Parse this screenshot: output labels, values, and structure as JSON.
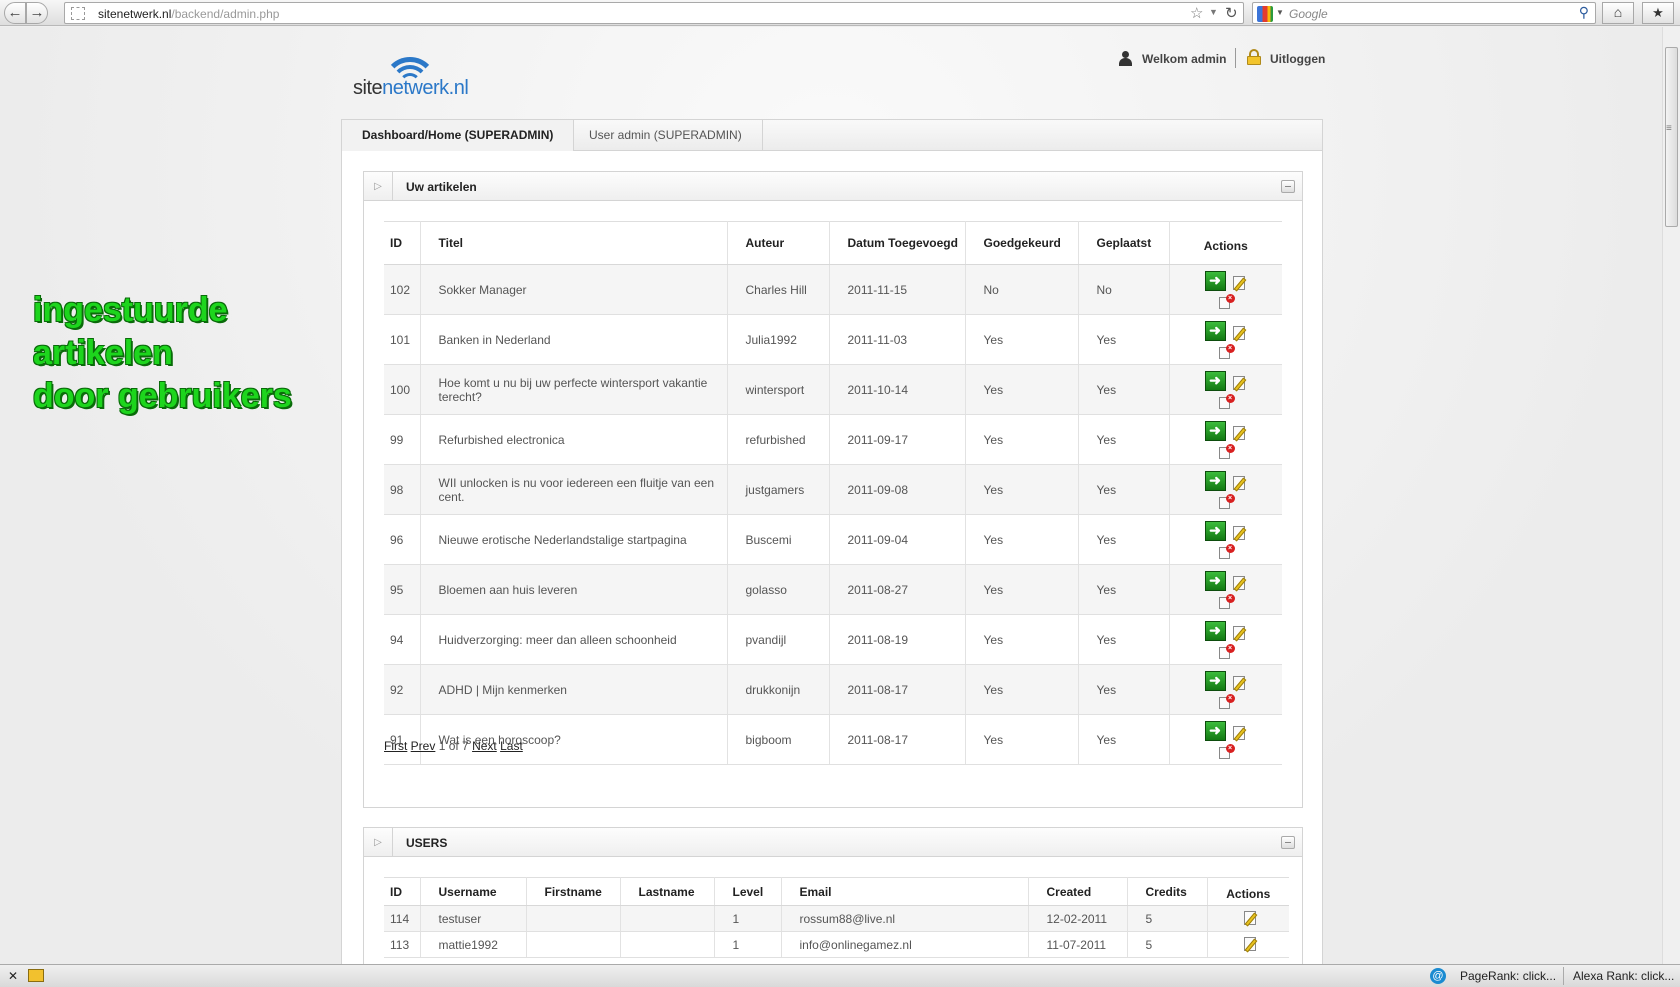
{
  "browser": {
    "url_domain": "sitenetwerk.nl",
    "url_path": "/backend/admin.php",
    "search_placeholder": "Google",
    "status_pagerank": "PageRank: click...",
    "status_alexa": "Alexa Rank: click..."
  },
  "header": {
    "logo_site": "site",
    "logo_rest": "netwerk.nl",
    "welcome": "Welkom admin",
    "logout": "Uitloggen"
  },
  "overlay": {
    "line1": "ingestuurde",
    "line2": "artikelen",
    "line3": "door gebruikers",
    "color": "#1dd51d"
  },
  "tabs": [
    {
      "label": "Dashboard/Home (SUPERADMIN)",
      "active": true
    },
    {
      "label": "User admin (SUPERADMIN)",
      "active": false
    }
  ],
  "articles": {
    "title": "Uw artikelen",
    "columns": [
      "ID",
      "Titel",
      "Auteur",
      "Datum Toegevoegd",
      "Goedgekeurd",
      "Geplaatst",
      "Actions"
    ],
    "rows": [
      {
        "id": "102",
        "titel": "Sokker Manager",
        "auteur": "Charles Hill",
        "datum": "2011-11-15",
        "goed": "No",
        "gepl": "No"
      },
      {
        "id": "101",
        "titel": "Banken in Nederland",
        "auteur": "Julia1992",
        "datum": "2011-11-03",
        "goed": "Yes",
        "gepl": "Yes"
      },
      {
        "id": "100",
        "titel": "Hoe komt u nu bij uw perfecte wintersport vakantie terecht?",
        "auteur": "wintersport",
        "datum": "2011-10-14",
        "goed": "Yes",
        "gepl": "Yes"
      },
      {
        "id": "99",
        "titel": "Refurbished electronica",
        "auteur": "refurbished",
        "datum": "2011-09-17",
        "goed": "Yes",
        "gepl": "Yes"
      },
      {
        "id": "98",
        "titel": "WII unlocken is nu voor iedereen een fluitje van een cent.",
        "auteur": "justgamers",
        "datum": "2011-09-08",
        "goed": "Yes",
        "gepl": "Yes"
      },
      {
        "id": "96",
        "titel": "Nieuwe erotische Nederlandstalige startpagina",
        "auteur": "Buscemi",
        "datum": "2011-09-04",
        "goed": "Yes",
        "gepl": "Yes"
      },
      {
        "id": "95",
        "titel": "Bloemen aan huis leveren",
        "auteur": "golasso",
        "datum": "2011-08-27",
        "goed": "Yes",
        "gepl": "Yes"
      },
      {
        "id": "94",
        "titel": "Huidverzorging: meer dan alleen schoonheid",
        "auteur": "pvandijl",
        "datum": "2011-08-19",
        "goed": "Yes",
        "gepl": "Yes"
      },
      {
        "id": "92",
        "titel": "ADHD | Mijn kenmerken",
        "auteur": "drukkonijn",
        "datum": "2011-08-17",
        "goed": "Yes",
        "gepl": "Yes"
      },
      {
        "id": "91",
        "titel": "Wat is een horoscoop?",
        "auteur": "bigboom",
        "datum": "2011-08-17",
        "goed": "Yes",
        "gepl": "Yes"
      }
    ],
    "pager": {
      "first": "First",
      "prev": "Prev",
      "info": "1 of 7",
      "next": "Next",
      "last": "Last"
    }
  },
  "users": {
    "title": "USERS",
    "columns": [
      "ID",
      "Username",
      "Firstname",
      "Lastname",
      "Level",
      "Email",
      "Created",
      "Credits",
      "Actions"
    ],
    "rows": [
      {
        "id": "114",
        "username": "testuser",
        "firstname": "",
        "lastname": "",
        "level": "1",
        "email": "rossum88@live.nl",
        "created": "12-02-2011",
        "credits": "5"
      },
      {
        "id": "113",
        "username": "mattie1992",
        "firstname": "",
        "lastname": "",
        "level": "1",
        "email": "info@onlinegamez.nl",
        "created": "11-07-2011",
        "credits": "5"
      }
    ]
  }
}
